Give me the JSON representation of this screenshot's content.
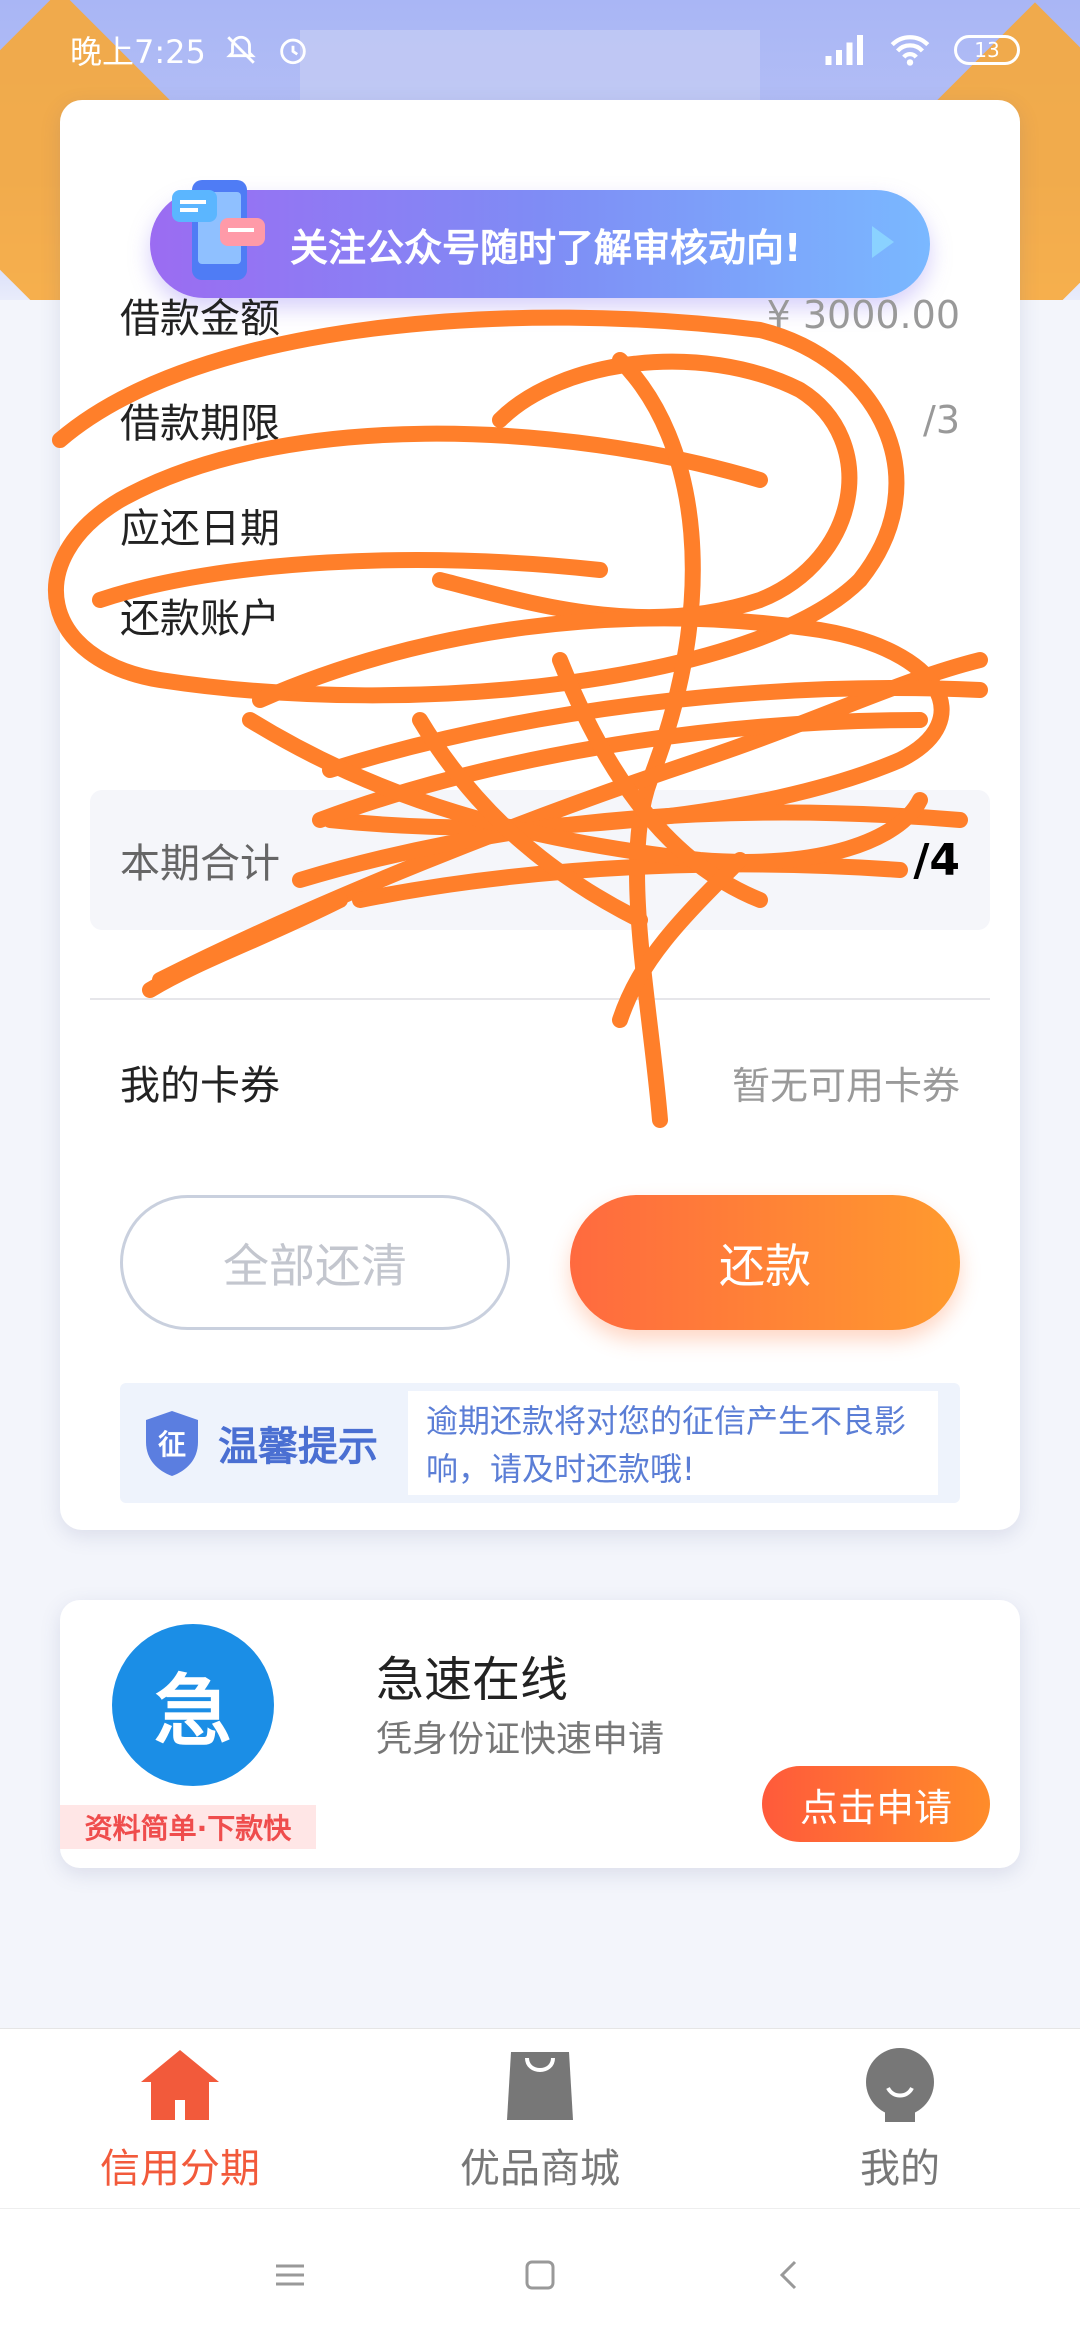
{
  "status_bar": {
    "time": "晚上7:25",
    "battery": "13"
  },
  "banner": {
    "text": "关注公众号随时了解审核动向!"
  },
  "loan": {
    "rows": [
      {
        "label": "借款金额",
        "value": "¥ 3000.00"
      },
      {
        "label": "借款期限",
        "value": "/3"
      },
      {
        "label": "应还日期",
        "value": ""
      },
      {
        "label": "还款账户",
        "value": ""
      }
    ],
    "total_label": "本期合计",
    "total_amount": "/4"
  },
  "coupon": {
    "label": "我的卡券",
    "value": "暂无可用卡券"
  },
  "buttons": {
    "clear": "全部还清",
    "repay": "还款"
  },
  "tip": {
    "icon_text": "征",
    "title": "温馨提示",
    "text": "逾期还款将对您的征信产生不良影响，请及时还款哦!"
  },
  "ad": {
    "logo_text": "急",
    "tag": "资料简单·下款快",
    "title": "急速在线",
    "subtitle": "凭身份证快速申请",
    "button": "点击申请"
  },
  "nav": {
    "items": [
      {
        "label": "信用分期",
        "icon": "home-icon",
        "active": true
      },
      {
        "label": "优品商城",
        "icon": "shopping-bag-icon",
        "active": false
      },
      {
        "label": "我的",
        "icon": "profile-icon",
        "active": false
      }
    ]
  },
  "colors": {
    "accent": "#ff6a3f",
    "scribble": "#ff7f2a",
    "tip_blue": "#4a6fd2"
  }
}
